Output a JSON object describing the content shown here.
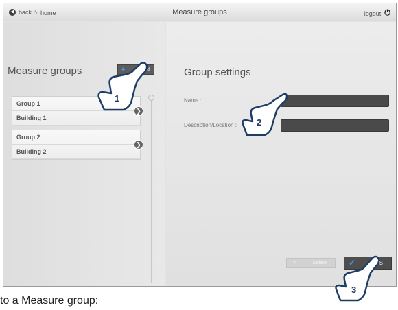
{
  "topbar": {
    "back_label": "back",
    "home_label": "home",
    "title": "Measure groups",
    "logout_label": "logout"
  },
  "left_panel": {
    "title": "Measure groups",
    "add_button_label": "dd",
    "groups": [
      {
        "name": "Group 1",
        "location": "Building 1"
      },
      {
        "name": "Group 2",
        "location": "Building 2"
      }
    ]
  },
  "right_panel": {
    "title": "Group settings",
    "name_label": "Name :",
    "name_value": "",
    "description_label": "Description/Location :",
    "description_value": "",
    "delete_button_label": "Delete",
    "save_button_label": "S"
  },
  "callouts": [
    {
      "number": "1"
    },
    {
      "number": "2"
    },
    {
      "number": "3"
    }
  ],
  "caption": "to a Measure group:",
  "colors": {
    "accent": "#3da0ea",
    "callout_outline": "#1e3d66",
    "field_bg": "#4a4a4a"
  },
  "icons": {
    "back": "back-circle-icon",
    "home": "home-icon",
    "logout": "power-icon",
    "add": "plus-icon",
    "chevron": "chevron-right-icon",
    "delete": "close-icon",
    "save": "checkmark-icon",
    "callout": "pointing-hand-icon"
  }
}
